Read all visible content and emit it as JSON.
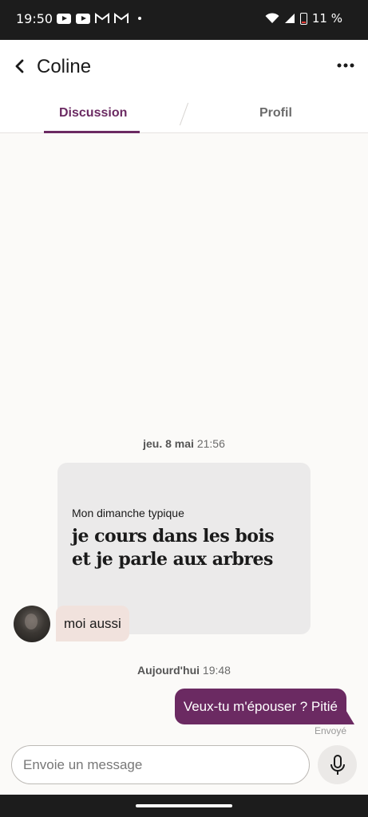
{
  "status_bar": {
    "time": "19:50",
    "battery": "11 %",
    "icons": [
      "youtube-icon",
      "youtube-icon",
      "gmail-icon",
      "gmail-icon",
      "notification-dot",
      "wifi-icon",
      "signal-icon",
      "battery-icon"
    ]
  },
  "header": {
    "title": "Coline",
    "back_icon": "back-arrow-icon",
    "more_icon": "more-horizontal-icon"
  },
  "tabs": [
    {
      "label": "Discussion",
      "active": true
    },
    {
      "label": "Profil",
      "active": false
    }
  ],
  "conversation": {
    "first_date": {
      "day": "jeu. 8 mai",
      "time": "21:56"
    },
    "prompt": {
      "question": "Mon dimanche typique",
      "answer": "je cours dans les bois et je parle aux arbres"
    },
    "reply": "moi aussi",
    "second_date": {
      "day": "Aujourd'hui",
      "time": "19:48"
    },
    "sent_message": "Veux-tu m'épouser ? Pitié",
    "sent_status": "Envoyé"
  },
  "composer": {
    "placeholder": "Envoie un message",
    "mic_icon": "microphone-icon"
  },
  "colors": {
    "accent": "#6b2a62",
    "reply_bubble": "#f1e2dd",
    "prompt_card": "#ebeaea"
  }
}
